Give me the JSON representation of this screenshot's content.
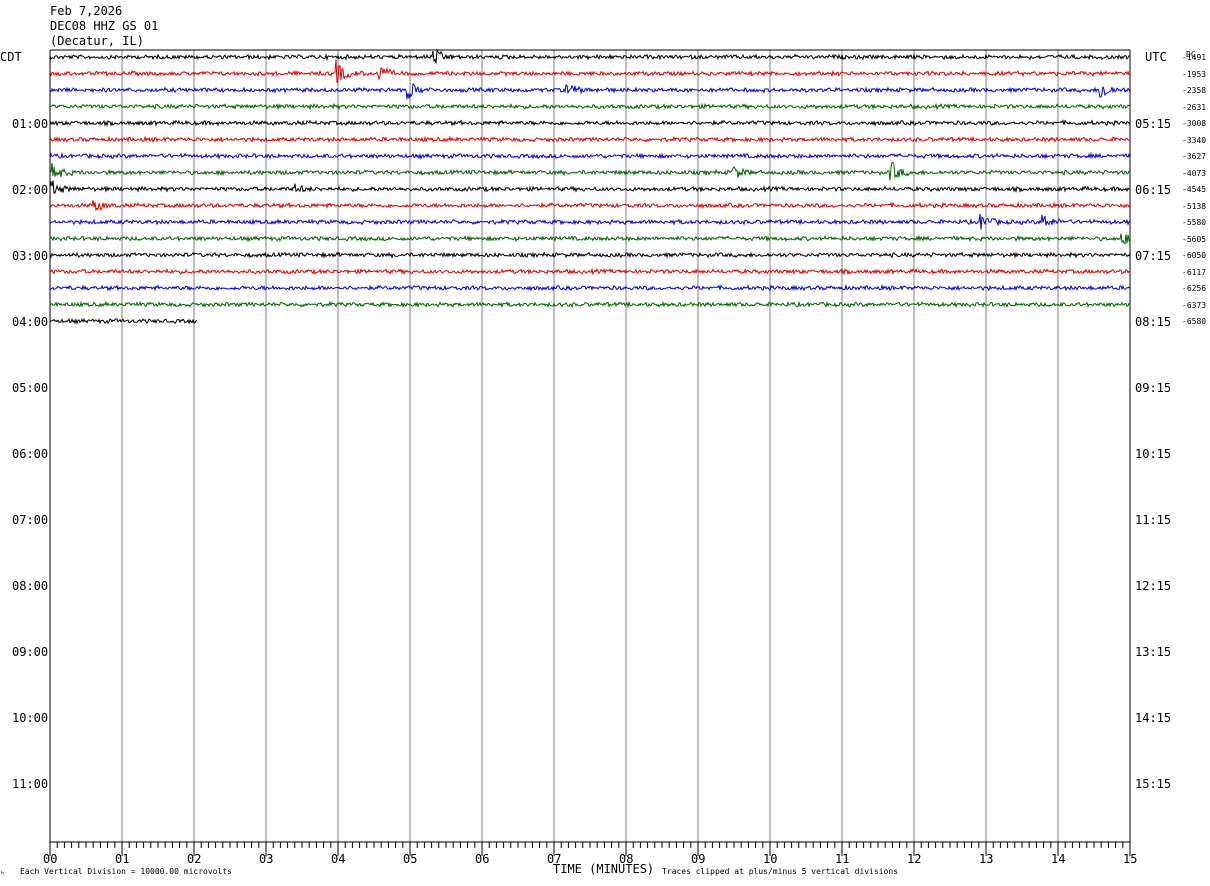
{
  "header": {
    "date": "Feb 7,2026",
    "station": "DEC08 HHZ GS 01",
    "location": "(Decatur, IL)"
  },
  "chart_data": {
    "type": "line",
    "left_axis_label": "CDT",
    "right_axis_label": "UTC",
    "dc_label": "DC",
    "xlabel": "TIME (MINUTES)",
    "x_ticks": [
      "00",
      "01",
      "02",
      "03",
      "04",
      "05",
      "06",
      "07",
      "08",
      "09",
      "10",
      "11",
      "12",
      "13",
      "14",
      "15"
    ],
    "xlim": [
      0,
      15
    ],
    "row_labels_left": [
      "01:00",
      "02:00",
      "03:00",
      "04:00",
      "05:00",
      "06:00",
      "07:00",
      "08:00",
      "09:00",
      "10:00",
      "11:00"
    ],
    "row_labels_right": [
      "05:15",
      "06:15",
      "07:15",
      "08:15",
      "09:15",
      "10:15",
      "11:15",
      "12:15",
      "13:15",
      "14:15",
      "15:15"
    ],
    "dc_offsets": [
      "-1491",
      "-1953",
      "-2358",
      "-2631",
      "-3008",
      "-3340",
      "-3627",
      "-4073",
      "-4545",
      "-5138",
      "-5580",
      "-5605",
      "-6050",
      "-6117",
      "-6256",
      "-6373",
      "-6580"
    ],
    "trace_colors": [
      "#000000",
      "#e00000",
      "#0000e0",
      "#006400"
    ],
    "trace_count": 17,
    "last_trace_end_minute": 2.05,
    "events": [
      {
        "trace": 0,
        "minute": 5.35,
        "amp": 7
      },
      {
        "trace": 1,
        "minute": 3.98,
        "amp": 12
      },
      {
        "trace": 1,
        "minute": 4.55,
        "amp": 9
      },
      {
        "trace": 2,
        "minute": 4.98,
        "amp": 8
      },
      {
        "trace": 2,
        "minute": 7.2,
        "amp": 5
      },
      {
        "trace": 2,
        "minute": 14.6,
        "amp": 10
      },
      {
        "trace": 7,
        "minute": 0.05,
        "amp": 8
      },
      {
        "trace": 7,
        "minute": 9.5,
        "amp": 6
      },
      {
        "trace": 7,
        "minute": 11.7,
        "amp": 9
      },
      {
        "trace": 8,
        "minute": 0.02,
        "amp": 8
      },
      {
        "trace": 8,
        "minute": 3.4,
        "amp": 4
      },
      {
        "trace": 9,
        "minute": 0.62,
        "amp": 6
      },
      {
        "trace": 10,
        "minute": 12.95,
        "amp": 7
      },
      {
        "trace": 10,
        "minute": 13.8,
        "amp": 7
      },
      {
        "trace": 11,
        "minute": 14.9,
        "amp": 6
      }
    ]
  },
  "footer": {
    "vertical_division": "Each Vertical Division = 10000.00 microvolts",
    "clip_note": "Traces clipped at plus/minus 5 vertical divisions",
    "corner_mark": "ʰ"
  }
}
